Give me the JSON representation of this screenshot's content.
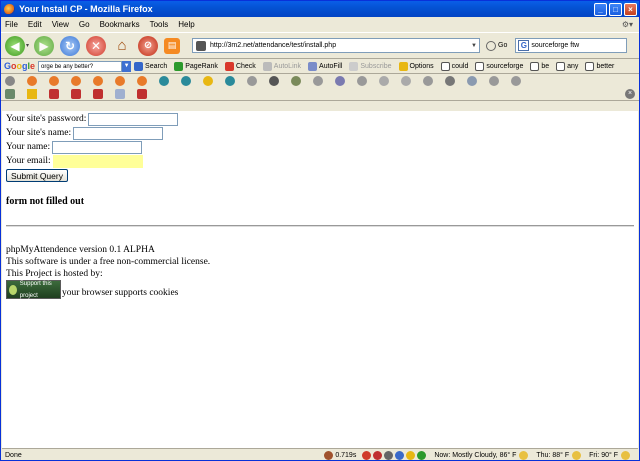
{
  "window": {
    "title": "Your Install CP - Mozilla Firefox",
    "minimize": "_",
    "maximize": "□",
    "close": "×"
  },
  "menu": {
    "items": [
      "File",
      "Edit",
      "View",
      "Go",
      "Bookmarks",
      "Tools",
      "Help"
    ],
    "gear": "⚙▾"
  },
  "nav": {
    "url": "http://3m2.net/attendance/test/install.php",
    "go_label": "Go",
    "search_value": "sourceforge ftw",
    "back": "◀",
    "forward": "▶",
    "reload": "↻",
    "stop": "✕",
    "home": "⌂",
    "rss": "▤",
    "block": "⊘"
  },
  "google_toolbar": {
    "query": "orge be any better?",
    "search_label": "Search",
    "pagerank_label": "PageRank",
    "check_label": "Check",
    "autolink_label": "AutoLink",
    "autofill_label": "AutoFill",
    "subscribe_label": "Subscribe",
    "options_label": "Options",
    "terms": [
      "could",
      "sourceforge",
      "be",
      "any",
      "better"
    ]
  },
  "form": {
    "password_label": "Your site's password:",
    "sitename_label": "Your site's name:",
    "name_label": "Your name:",
    "email_label": "Your email:",
    "submit_label": "Submit Query",
    "error": "form not filled out"
  },
  "footer": {
    "version": "phpMyAttendence version 0.1 ALPHA",
    "license": "This software is under a free non-commercial license.",
    "hosted": "This Project is hosted by:",
    "badge": "Support this project",
    "cookies": "your browser supports cookies"
  },
  "status": {
    "text": "Done",
    "timing": "0.719s",
    "weather_now": "Now: Mostly Cloudy, 86° F",
    "weather_thu": "Thu: 88° F",
    "weather_fri": "Fri: 90° F"
  },
  "colors": {
    "titlebar": "#0453d4",
    "email_highlight": "#ffff99",
    "accent": "#0831d9"
  }
}
